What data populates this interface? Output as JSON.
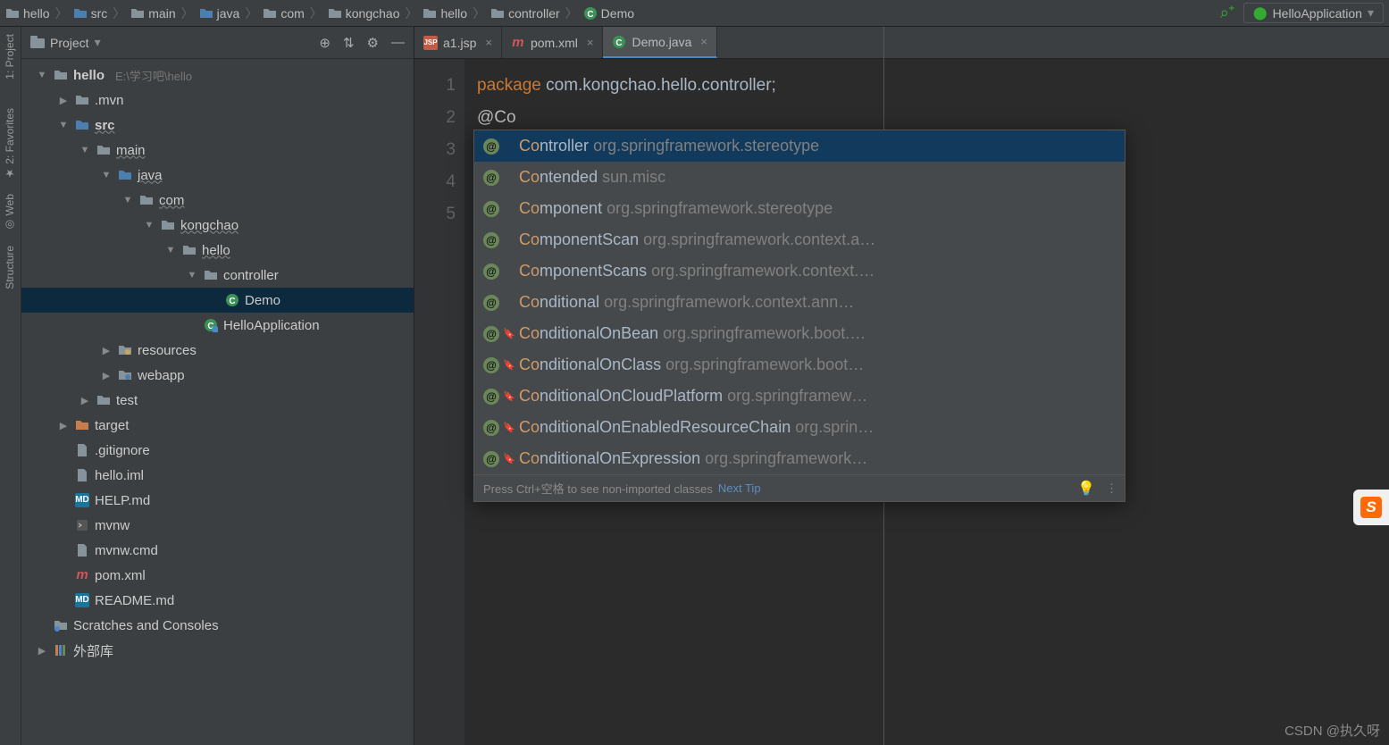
{
  "breadcrumb": [
    {
      "icon": "folder",
      "text": "hello"
    },
    {
      "icon": "folder-src",
      "text": "src"
    },
    {
      "icon": "folder",
      "text": "main"
    },
    {
      "icon": "folder-src",
      "text": "java"
    },
    {
      "icon": "folder",
      "text": "com"
    },
    {
      "icon": "folder",
      "text": "kongchao"
    },
    {
      "icon": "folder",
      "text": "hello"
    },
    {
      "icon": "folder",
      "text": "controller"
    },
    {
      "icon": "class",
      "text": "Demo"
    }
  ],
  "run_config": "HelloApplication",
  "sidebar": {
    "title": "Project",
    "tools": [
      "⊕",
      "⇅",
      "⚙",
      "—"
    ]
  },
  "left_tools": [
    {
      "label": "1: Project"
    },
    {
      "label": ""
    },
    {
      "label": "2: Favorites"
    },
    {
      "label": "Web"
    },
    {
      "label": "Structure"
    }
  ],
  "tree": [
    {
      "depth": 0,
      "arrow": "▼",
      "icon": "folder",
      "name": "hello",
      "dim": "E:\\学习吧\\hello",
      "bold": true
    },
    {
      "depth": 1,
      "arrow": "▶",
      "icon": "folder",
      "name": ".mvn"
    },
    {
      "depth": 1,
      "arrow": "▼",
      "icon": "folder-src",
      "name": "src",
      "bold": true,
      "wavy": true
    },
    {
      "depth": 2,
      "arrow": "▼",
      "icon": "folder",
      "name": "main",
      "wavy": true
    },
    {
      "depth": 3,
      "arrow": "▼",
      "icon": "folder-src",
      "name": "java",
      "wavy": true
    },
    {
      "depth": 4,
      "arrow": "▼",
      "icon": "folder",
      "name": "com",
      "wavy": true
    },
    {
      "depth": 5,
      "arrow": "▼",
      "icon": "folder",
      "name": "kongchao",
      "wavy": true
    },
    {
      "depth": 6,
      "arrow": "▼",
      "icon": "folder",
      "name": "hello",
      "wavy": true
    },
    {
      "depth": 7,
      "arrow": "▼",
      "icon": "folder",
      "name": "controller"
    },
    {
      "depth": 8,
      "arrow": "",
      "icon": "class",
      "name": "Demo",
      "sel": true
    },
    {
      "depth": 7,
      "arrow": "",
      "icon": "class-run",
      "name": "HelloApplication"
    },
    {
      "depth": 3,
      "arrow": "▶",
      "icon": "folder-res",
      "name": "resources"
    },
    {
      "depth": 3,
      "arrow": "▶",
      "icon": "folder-web",
      "name": "webapp"
    },
    {
      "depth": 2,
      "arrow": "▶",
      "icon": "folder",
      "name": "test"
    },
    {
      "depth": 1,
      "arrow": "▶",
      "icon": "folder-exc",
      "name": "target"
    },
    {
      "depth": 1,
      "arrow": "",
      "icon": "file",
      "name": ".gitignore"
    },
    {
      "depth": 1,
      "arrow": "",
      "icon": "file",
      "name": "hello.iml"
    },
    {
      "depth": 1,
      "arrow": "",
      "icon": "md",
      "name": "HELP.md"
    },
    {
      "depth": 1,
      "arrow": "",
      "icon": "sh",
      "name": "mvnw"
    },
    {
      "depth": 1,
      "arrow": "",
      "icon": "file",
      "name": "mvnw.cmd"
    },
    {
      "depth": 1,
      "arrow": "",
      "icon": "m",
      "name": "pom.xml"
    },
    {
      "depth": 1,
      "arrow": "",
      "icon": "md",
      "name": "README.md"
    },
    {
      "depth": 0,
      "arrow": "",
      "icon": "scratch",
      "name": "Scratches and Consoles"
    },
    {
      "depth": 0,
      "arrow": "▶",
      "icon": "lib",
      "name": "外部库"
    }
  ],
  "tabs": [
    {
      "icon": "jsp",
      "label": "a1.jsp",
      "active": false
    },
    {
      "icon": "m",
      "label": "pom.xml",
      "active": false
    },
    {
      "icon": "class",
      "label": "Demo.java",
      "active": true
    }
  ],
  "gutter": [
    "1",
    "2",
    "3",
    "4",
    "5"
  ],
  "code": {
    "l1_kw": "package",
    "l1_pkg": " com.kongchao.hello.controller;",
    "l2_ann": "@",
    "l2_rest": "Co"
  },
  "popup_hl": "Co",
  "popup": [
    {
      "sub": "",
      "name": "ntroller",
      "ns": "org.springframework.stereotype",
      "sel": true
    },
    {
      "sub": "",
      "name": "ntended",
      "ns": "sun.misc"
    },
    {
      "sub": "",
      "name": "mponent",
      "ns": "org.springframework.stereotype"
    },
    {
      "sub": "",
      "name": "mponentScan",
      "ns": "org.springframework.context.a…"
    },
    {
      "sub": "",
      "name": "mponentScans",
      "ns": "org.springframework.context.…"
    },
    {
      "sub": "",
      "name": "nditional",
      "ns": "org.springframework.context.ann…"
    },
    {
      "sub": "🔖",
      "name": "nditionalOnBean",
      "ns": "org.springframework.boot.…"
    },
    {
      "sub": "🔖",
      "name": "nditionalOnClass",
      "ns": "org.springframework.boot…"
    },
    {
      "sub": "🔖",
      "name": "nditionalOnCloudPlatform",
      "ns": "org.springframew…"
    },
    {
      "sub": "🔖",
      "name": "nditionalOnEnabledResourceChain",
      "ns": "org.sprin…"
    },
    {
      "sub": "🔖",
      "name": "nditionalOnExpression",
      "ns": "org.springframework…"
    }
  ],
  "popup_footer": {
    "hint": "Press Ctrl+空格 to see non-imported classes",
    "link": "Next Tip"
  },
  "watermark": "CSDN @执久呀"
}
